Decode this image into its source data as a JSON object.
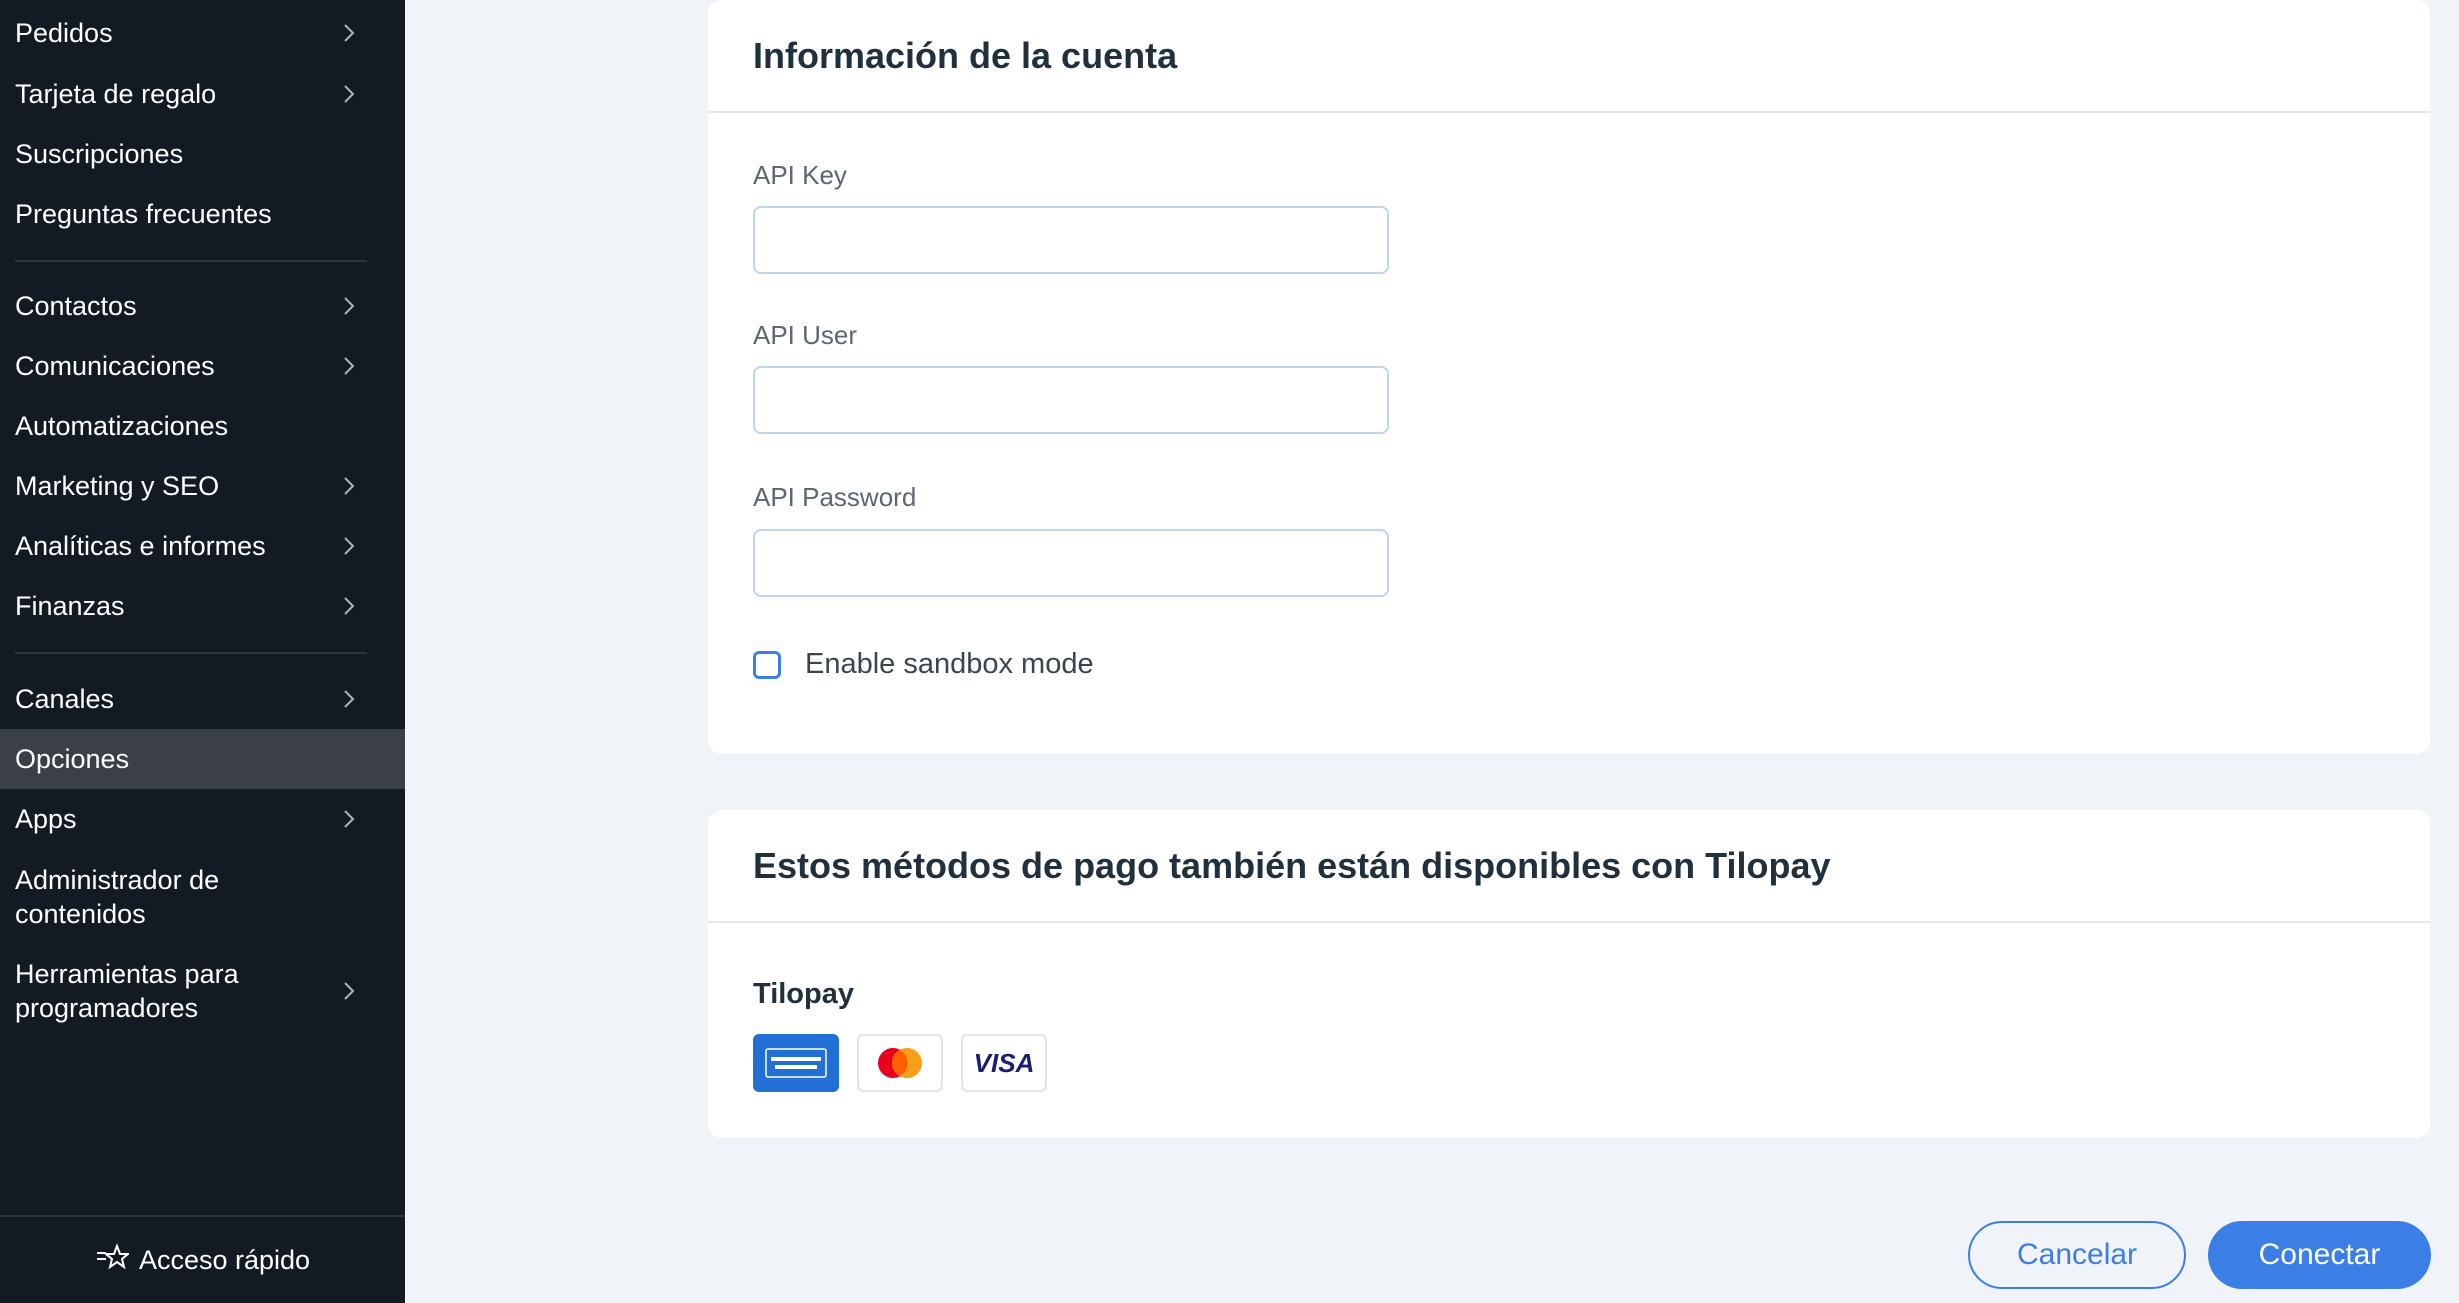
{
  "sidebar": {
    "items": [
      {
        "label": "Pedidos",
        "chevron": true
      },
      {
        "label": "Tarjeta de regalo",
        "chevron": true
      },
      {
        "label": "Suscripciones",
        "chevron": false
      },
      {
        "label": "Preguntas frecuentes",
        "chevron": false
      },
      {
        "label": "Contactos",
        "chevron": true
      },
      {
        "label": "Comunicaciones",
        "chevron": true
      },
      {
        "label": "Automatizaciones",
        "chevron": false
      },
      {
        "label": "Marketing y SEO",
        "chevron": true
      },
      {
        "label": "Analíticas e informes",
        "chevron": true
      },
      {
        "label": "Finanzas",
        "chevron": true
      },
      {
        "label": "Canales",
        "chevron": true
      },
      {
        "label": "Opciones",
        "chevron": false,
        "active": true
      },
      {
        "label": "Apps",
        "chevron": true
      },
      {
        "label": "Administrador de contenidos",
        "chevron": false
      },
      {
        "label": "Herramientas para programadores",
        "chevron": true
      }
    ],
    "quick_access_label": "Acceso rápido"
  },
  "account_card": {
    "title": "Información de la cuenta",
    "fields": [
      {
        "label": "API Key",
        "value": "",
        "placeholder": ""
      },
      {
        "label": "API User",
        "value": "",
        "placeholder": ""
      },
      {
        "label": "API Password",
        "value": "",
        "placeholder": ""
      }
    ],
    "sandbox_label": "Enable sandbox mode",
    "sandbox_checked": false
  },
  "methods_card": {
    "title": "Estos métodos de pago también están disponibles con Tilopay",
    "provider": "Tilopay",
    "icons": [
      "amex-icon",
      "mastercard-icon",
      "visa-icon"
    ],
    "visa_text": "VISA"
  },
  "buttons": {
    "cancel": "Cancelar",
    "connect": "Conectar"
  },
  "colors": {
    "sidebar_bg": "#131a24",
    "active_item_bg": "#3b4048",
    "accent": "#3b7fe6",
    "page_bg": "#f0f3f7"
  }
}
